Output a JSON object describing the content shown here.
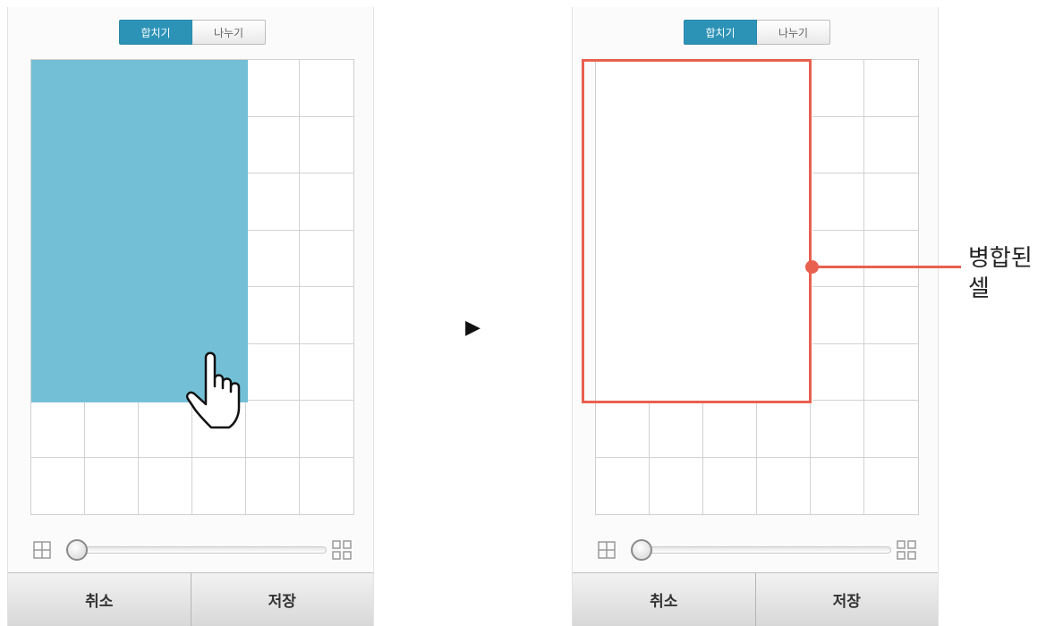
{
  "panels": {
    "left": {
      "merge_label": "합치기",
      "split_label": "나누기",
      "cancel_label": "취소",
      "save_label": "저장"
    },
    "right": {
      "merge_label": "합치기",
      "split_label": "나누기",
      "cancel_label": "취소",
      "save_label": "저장"
    }
  },
  "grid": {
    "columns": 6,
    "rows": 8
  },
  "callout": {
    "label": "병합된 셀"
  },
  "colors": {
    "selection": "#73c0d6",
    "merge_active": "#2c93b7",
    "callout": "#e8614f"
  },
  "icons": {
    "step_arrow": "triangle-right-icon",
    "few_cells": "grid-small-icon",
    "many_cells": "grid-large-icon",
    "hand": "hand-pointer-icon"
  }
}
